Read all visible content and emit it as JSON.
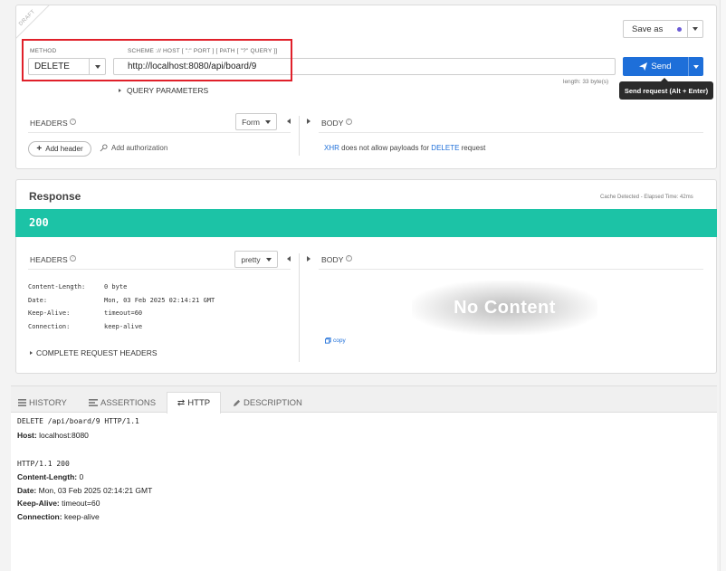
{
  "request": {
    "draft_label": "DRAFT",
    "method_label": "METHOD",
    "method_value": "DELETE",
    "url_label": "SCHEME :// HOST [ \":\" PORT ] [ PATH [ \"?\" QUERY ]]",
    "url_value": "http://localhost:8080/api/board/9",
    "query_params_label": "QUERY PARAMETERS",
    "length_text": "length: 33 byte(s)",
    "save_as_label": "Save as",
    "send_label": "Send",
    "tooltip": "Send request (Alt + Enter)",
    "headers_label": "HEADERS",
    "form_label": "Form",
    "body_label": "BODY",
    "add_header_label": "Add header",
    "add_authorization_label": "Add authorization",
    "body_message": {
      "xhr": "XHR",
      "middle": " does not allow payloads for ",
      "method": "DELETE",
      "end": " request"
    }
  },
  "response": {
    "title": "Response",
    "cache_info": "Cache Detected - Elapsed Time: 42ms",
    "status_code": "200",
    "headers_label": "HEADERS",
    "pretty_label": "pretty",
    "body_label": "BODY",
    "headers": [
      {
        "name": "Content-Length:",
        "value": "0 byte"
      },
      {
        "name": "Date:",
        "value": "Mon, 03 Feb 2025 02:14:21 GMT"
      },
      {
        "name": "Keep-Alive:",
        "value": "timeout=60"
      },
      {
        "name": "Connection:",
        "value": "keep-alive"
      }
    ],
    "no_content": "No Content",
    "copy_label": "copy",
    "complete_headers_label": "COMPLETE REQUEST HEADERS"
  },
  "bottom_tabs": [
    {
      "label": "HISTORY",
      "active": false
    },
    {
      "label": "ASSERTIONS",
      "active": false
    },
    {
      "label": "HTTP",
      "active": true
    },
    {
      "label": "DESCRIPTION",
      "active": false
    }
  ],
  "http_log": {
    "request_line": "DELETE /api/board/9 HTTP/1.1",
    "host_key": "Host:",
    "host_val": " localhost:8080",
    "status_line": "HTTP/1.1 200",
    "lines": [
      {
        "key": "Content-Length:",
        "val": " 0"
      },
      {
        "key": "Date:",
        "val": " Mon, 03 Feb 2025 02:14:21 GMT"
      },
      {
        "key": "Keep-Alive:",
        "val": " timeout=60"
      },
      {
        "key": "Connection:",
        "val": " keep-alive"
      }
    ]
  },
  "colors": {
    "accent_blue": "#1e6fd9",
    "status_teal": "#1cc3a6",
    "highlight_red": "#e0202a",
    "dot_purple": "#6b5bd6"
  }
}
